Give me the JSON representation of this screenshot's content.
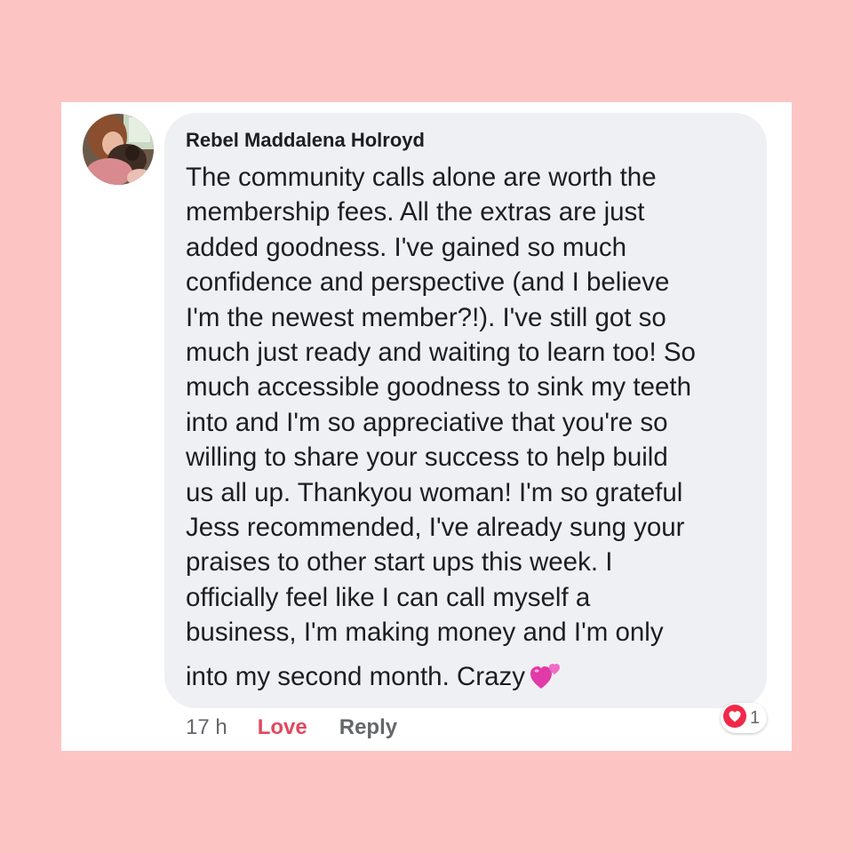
{
  "comment": {
    "author": "Rebel Maddalena Holroyd",
    "lines": [
      "The community calls alone are worth the",
      "membership fees. All the extras are just",
      "added goodness. I've gained so much",
      "confidence and perspective (and I believe",
      "I'm the newest member?!). I've still got so",
      "much just ready and waiting to learn too! So",
      "much accessible goodness to sink my teeth",
      "into and I'm so appreciative that you're so",
      "willing to share your success to help build",
      "us all up. Thankyou woman! I'm so grateful",
      "Jess recommended, I've already sung your",
      "praises to other start ups this week. I",
      "officially feel like I can call myself a",
      "business, I'm making money and I'm only",
      "into my second month. Crazy"
    ],
    "emoji": "two-hearts-icon"
  },
  "actions": {
    "time": "17 h",
    "love_label": "Love",
    "reply_label": "Reply"
  },
  "reaction": {
    "icon": "love-reaction-icon",
    "count": "1"
  },
  "colors": {
    "page_background": "#fcc5c4",
    "bubble": "#eff0f3",
    "love": "#e2485d",
    "muted": "#65676b"
  }
}
